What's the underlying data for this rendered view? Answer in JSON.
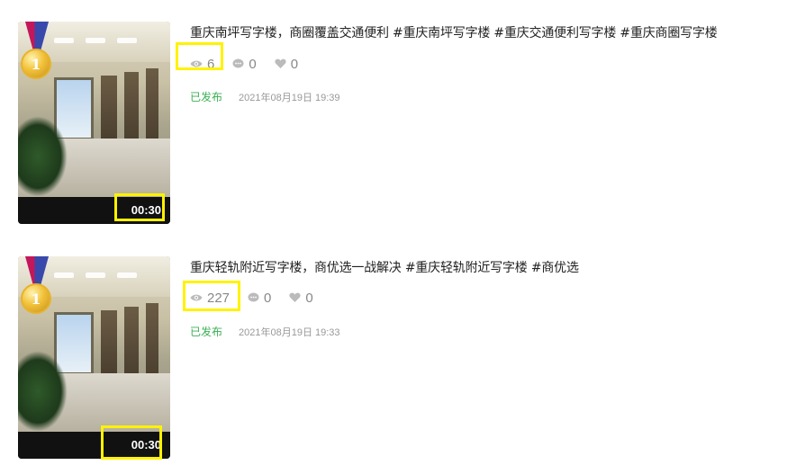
{
  "videos": [
    {
      "title": "重庆南坪写字楼，商圈覆盖交通便利 #重庆南坪写字楼 #重庆交通便利写字楼 #重庆商圈写字楼",
      "views": "6",
      "comments": "0",
      "likes": "0",
      "status": "已发布",
      "date": "2021年08月19日 19:39",
      "duration": "00:30",
      "medal_text": "1"
    },
    {
      "title": "重庆轻轨附近写字楼，商优选一战解决 #重庆轻轨附近写字楼 #商优选",
      "views": "227",
      "comments": "0",
      "likes": "0",
      "status": "已发布",
      "date": "2021年08月19日 19:33",
      "duration": "00:30",
      "medal_text": "1"
    }
  ],
  "colors": {
    "status_green": "#3ab054",
    "highlight_yellow": "#fff200",
    "stat_gray": "#888888"
  }
}
